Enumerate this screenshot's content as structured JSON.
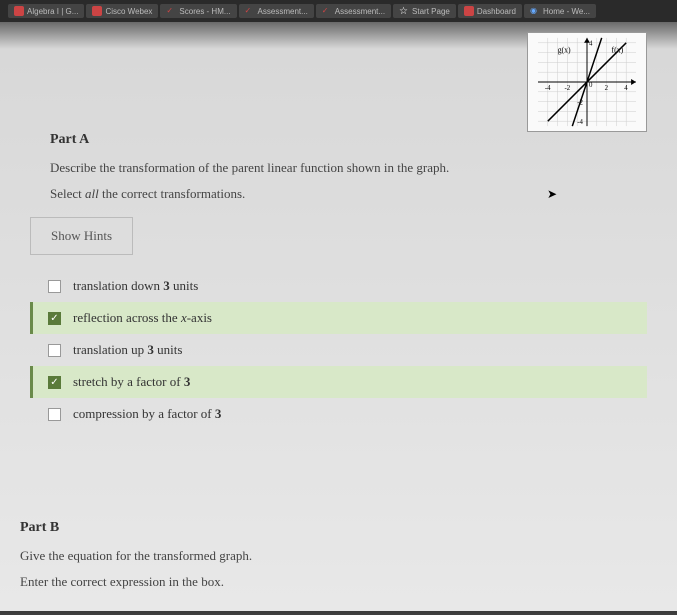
{
  "tabs": [
    {
      "label": "Algebra I | G...",
      "icon": "red"
    },
    {
      "label": "Cisco Webex",
      "icon": "red"
    },
    {
      "label": "Scores - HM...",
      "icon": "check"
    },
    {
      "label": "Assessment...",
      "icon": "check"
    },
    {
      "label": "Assessment...",
      "icon": "check"
    },
    {
      "label": "Start Page",
      "icon": "star"
    },
    {
      "label": "Dashboard",
      "icon": "red"
    },
    {
      "label": "Home - We...",
      "icon": "globe"
    }
  ],
  "graph": {
    "gx_label": "g(x)",
    "fx_label": "f(x)",
    "ticks": [
      "-4",
      "-2",
      "0",
      "2",
      "4"
    ],
    "y_top": "4",
    "y_mid_neg": "-2",
    "y_bot": "-4"
  },
  "partA": {
    "title": "Part A",
    "question": "Describe the transformation of the parent linear function shown in the graph.",
    "instruction_pre": "Select ",
    "instruction_em": "all",
    "instruction_post": " the correct transformations.",
    "hints": "Show Hints",
    "options": [
      {
        "pre": "translation down ",
        "num": "3",
        "post": " units",
        "checked": false
      },
      {
        "pre": "reflection across the ",
        "var": "x",
        "post": "-axis",
        "checked": true
      },
      {
        "pre": "translation up ",
        "num": "3",
        "post": " units",
        "checked": false
      },
      {
        "pre": "stretch by a factor of ",
        "num": "3",
        "post": "",
        "checked": true
      },
      {
        "pre": "compression by a factor of ",
        "num": "3",
        "post": "",
        "checked": false
      }
    ]
  },
  "partB": {
    "title": "Part B",
    "question": "Give the equation for the transformed graph.",
    "instruction": "Enter the correct expression in the box."
  }
}
